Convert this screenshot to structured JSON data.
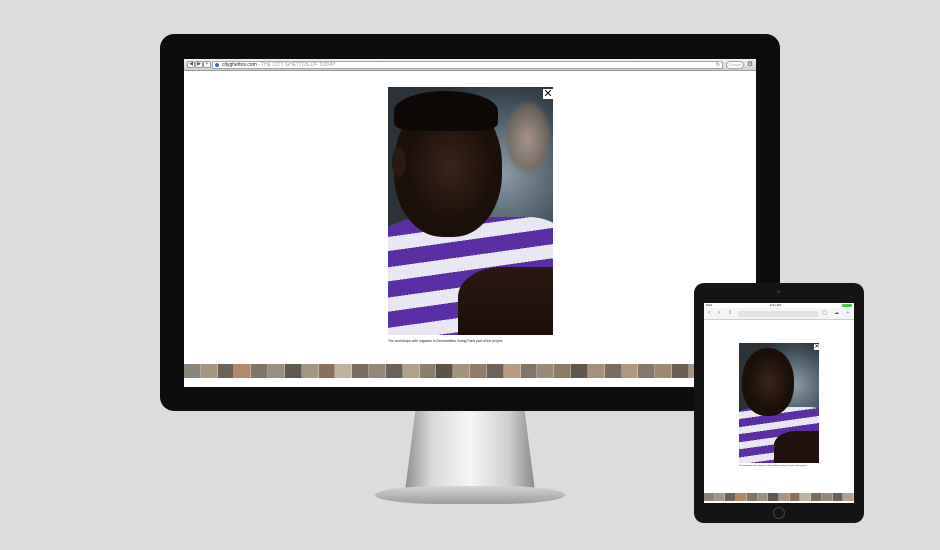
{
  "browser": {
    "back": "◀",
    "forward": "▶",
    "add": "+",
    "url_domain": "cityghettos.com",
    "url_subtitle": "- THE CITY GHETTOS OF TODAY",
    "reload": "↻",
    "search_placeholder": "Google",
    "settings": "⚙"
  },
  "viewer": {
    "close": "✕",
    "caption": "The workshops with migrants in Gennevilliers during Paris part of the project"
  },
  "thumbnail_colors": [
    "#8b8478",
    "#a69580",
    "#6b6357",
    "#b08a6a",
    "#7d7669",
    "#9b8f7e",
    "#5e5a52",
    "#a39784",
    "#8a6f5a",
    "#bdb1a0",
    "#7b6e60",
    "#948775",
    "#6a625a",
    "#b3a18a",
    "#8d7f6d",
    "#5b5248",
    "#a5947c",
    "#907c68",
    "#6e6459",
    "#b69c80",
    "#80766a",
    "#9a8b76",
    "#8f7b64",
    "#5f564c",
    "#a6917a",
    "#7a6e62",
    "#b19980",
    "#85796b",
    "#9c8a72",
    "#6b5f52",
    "#a89680",
    "#8c7d6a",
    "#b09578",
    "#7b6d5f"
  ],
  "tablet": {
    "status_left": "iPad",
    "status_time": "9:41 AM",
    "back": "‹",
    "forward": "›",
    "share": "⇪",
    "icons": "▢ ☁ +",
    "close": "✕",
    "caption": "The workshops with migrants in Gennevilliers during Paris part of the project"
  }
}
